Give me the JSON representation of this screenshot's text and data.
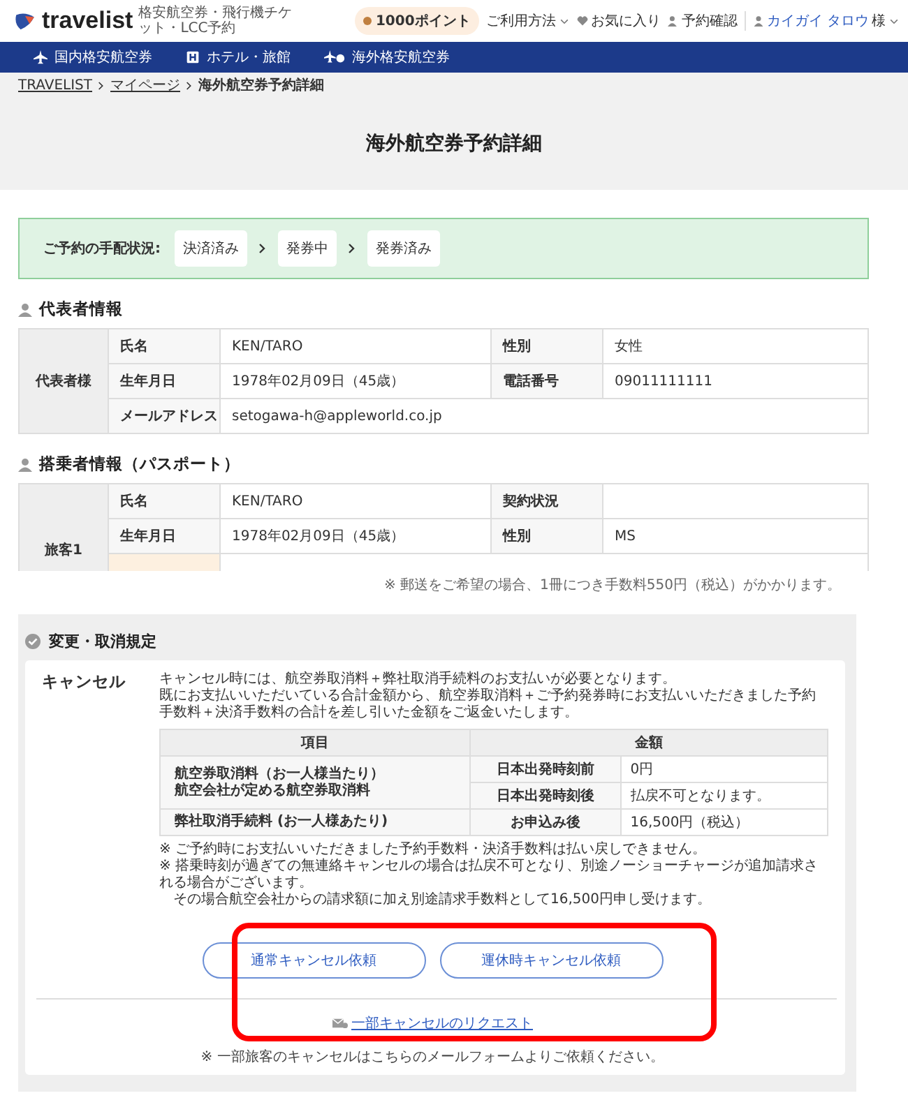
{
  "header": {
    "logo": "travelist",
    "tagline": "格安航空券・飛行機チケット・LCC予約",
    "points": "1000ポイント",
    "menu": [
      {
        "label": "ご利用方法",
        "kind": "dropdown"
      },
      {
        "label": "お気に入り",
        "kind": "heart"
      },
      {
        "label": "予約確認",
        "kind": "person"
      }
    ],
    "user": {
      "name": "カイガイ タロウ",
      "suffix": "様"
    }
  },
  "nav": [
    {
      "label": "国内格安航空券",
      "kind": "plane"
    },
    {
      "label": "ホテル・旅館",
      "kind": "hotel"
    },
    {
      "label": "海外格安航空券",
      "kind": "globe-plane"
    }
  ],
  "breadcrumb": [
    {
      "label": "TRAVELIST",
      "link": true
    },
    {
      "label": "マイページ",
      "link": true
    },
    {
      "label": "海外航空券予約詳細",
      "link": false
    }
  ],
  "page_title": "海外航空券予約詳細",
  "status": {
    "label": "ご予約の手配状況:",
    "steps": [
      "決済済み",
      "発券中",
      "発券済み"
    ]
  },
  "representative": {
    "title": "代表者情報",
    "group": "代表者様",
    "rows": [
      [
        "氏名",
        "KEN/TARO",
        "性別",
        "女性"
      ],
      [
        "生年月日",
        "1978年02月09日（45歳）",
        "電話番号",
        "09011111111"
      ],
      [
        "メールアドレス",
        "setogawa-h@appleworld.co.jp"
      ]
    ]
  },
  "passengers": {
    "title": "搭乗者情報（パスポート）",
    "group": "旅客1",
    "rows": [
      [
        "氏名",
        "KEN/TARO",
        "契約状況",
        ""
      ],
      [
        "生年月日",
        "1978年02月09日（45歳）",
        "性別",
        "MS"
      ]
    ]
  },
  "cut_note": "※ 郵送をご希望の場合、1冊につき手数料550円（税込）がかかります。",
  "policy": {
    "title": "変更・取消規定",
    "heading": "キャンセル",
    "text": [
      "キャンセル時には、航空券取消料＋弊社取消手続料のお支払いが必要となります。",
      "既にお支払いいただいている合計金額から、航空券取消料＋ご予約発券時にお支払いいただきました予約手数料＋決済手数料の合計を差し引いた金額をご返金いたします。"
    ],
    "table": {
      "columns": [
        "項目",
        "金額"
      ],
      "rows": [
        {
          "item": [
            "航空券取消料（お一人様当たり）",
            "航空会社が定める航空券取消料"
          ],
          "sub": [
            [
              "日本出発時刻前",
              "0円"
            ],
            [
              "日本出発時刻後",
              "払戻不可となります。"
            ]
          ]
        },
        {
          "item": [
            "弊社取消手続料 (お一人様あたり)"
          ],
          "sub": [
            [
              "お申込み後",
              "16,500円（税込）"
            ]
          ]
        }
      ]
    },
    "notes": [
      "※ ご予約時にお支払いいただきました予約手数料・決済手数料は払い戻しできません。",
      "※ 搭乗時刻が過ぎての無連絡キャンセルの場合は払戻不可となり、別途ノーショーチャージが追加請求される場合がございます。",
      "その場合航空会社からの請求額に加え別途請求手数料として16,500円申し受けます。"
    ],
    "buttons": [
      "通常キャンセル依頼",
      "運休時キャンセル依頼"
    ],
    "link": "一部キャンセルのリクエスト",
    "footnote": "※ 一部旅客のキャンセルはこちらのメールフォームよりご依頼ください。"
  }
}
